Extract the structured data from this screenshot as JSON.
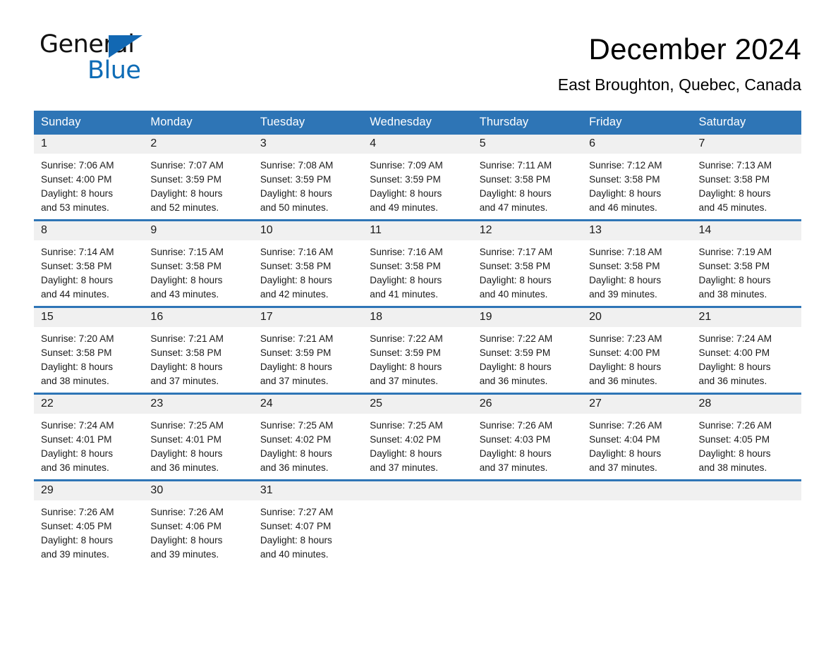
{
  "brand": {
    "word_one": "General",
    "word_two": "Blue",
    "flag_icon": "triangle-flag-icon"
  },
  "header": {
    "month_title": "December 2024",
    "location": "East Broughton, Quebec, Canada"
  },
  "colors": {
    "accent_blue": "#2e75b6",
    "brand_blue": "#0e6cb6",
    "daynum_band": "#f0f0f0",
    "text": "#1a1a1a"
  },
  "calendar": {
    "day_headers": [
      "Sunday",
      "Monday",
      "Tuesday",
      "Wednesday",
      "Thursday",
      "Friday",
      "Saturday"
    ],
    "weeks": [
      [
        {
          "day": "1",
          "sunrise": "Sunrise: 7:06 AM",
          "sunset": "Sunset: 4:00 PM",
          "daylight_line1": "Daylight: 8 hours",
          "daylight_line2": "and 53 minutes."
        },
        {
          "day": "2",
          "sunrise": "Sunrise: 7:07 AM",
          "sunset": "Sunset: 3:59 PM",
          "daylight_line1": "Daylight: 8 hours",
          "daylight_line2": "and 52 minutes."
        },
        {
          "day": "3",
          "sunrise": "Sunrise: 7:08 AM",
          "sunset": "Sunset: 3:59 PM",
          "daylight_line1": "Daylight: 8 hours",
          "daylight_line2": "and 50 minutes."
        },
        {
          "day": "4",
          "sunrise": "Sunrise: 7:09 AM",
          "sunset": "Sunset: 3:59 PM",
          "daylight_line1": "Daylight: 8 hours",
          "daylight_line2": "and 49 minutes."
        },
        {
          "day": "5",
          "sunrise": "Sunrise: 7:11 AM",
          "sunset": "Sunset: 3:58 PM",
          "daylight_line1": "Daylight: 8 hours",
          "daylight_line2": "and 47 minutes."
        },
        {
          "day": "6",
          "sunrise": "Sunrise: 7:12 AM",
          "sunset": "Sunset: 3:58 PM",
          "daylight_line1": "Daylight: 8 hours",
          "daylight_line2": "and 46 minutes."
        },
        {
          "day": "7",
          "sunrise": "Sunrise: 7:13 AM",
          "sunset": "Sunset: 3:58 PM",
          "daylight_line1": "Daylight: 8 hours",
          "daylight_line2": "and 45 minutes."
        }
      ],
      [
        {
          "day": "8",
          "sunrise": "Sunrise: 7:14 AM",
          "sunset": "Sunset: 3:58 PM",
          "daylight_line1": "Daylight: 8 hours",
          "daylight_line2": "and 44 minutes."
        },
        {
          "day": "9",
          "sunrise": "Sunrise: 7:15 AM",
          "sunset": "Sunset: 3:58 PM",
          "daylight_line1": "Daylight: 8 hours",
          "daylight_line2": "and 43 minutes."
        },
        {
          "day": "10",
          "sunrise": "Sunrise: 7:16 AM",
          "sunset": "Sunset: 3:58 PM",
          "daylight_line1": "Daylight: 8 hours",
          "daylight_line2": "and 42 minutes."
        },
        {
          "day": "11",
          "sunrise": "Sunrise: 7:16 AM",
          "sunset": "Sunset: 3:58 PM",
          "daylight_line1": "Daylight: 8 hours",
          "daylight_line2": "and 41 minutes."
        },
        {
          "day": "12",
          "sunrise": "Sunrise: 7:17 AM",
          "sunset": "Sunset: 3:58 PM",
          "daylight_line1": "Daylight: 8 hours",
          "daylight_line2": "and 40 minutes."
        },
        {
          "day": "13",
          "sunrise": "Sunrise: 7:18 AM",
          "sunset": "Sunset: 3:58 PM",
          "daylight_line1": "Daylight: 8 hours",
          "daylight_line2": "and 39 minutes."
        },
        {
          "day": "14",
          "sunrise": "Sunrise: 7:19 AM",
          "sunset": "Sunset: 3:58 PM",
          "daylight_line1": "Daylight: 8 hours",
          "daylight_line2": "and 38 minutes."
        }
      ],
      [
        {
          "day": "15",
          "sunrise": "Sunrise: 7:20 AM",
          "sunset": "Sunset: 3:58 PM",
          "daylight_line1": "Daylight: 8 hours",
          "daylight_line2": "and 38 minutes."
        },
        {
          "day": "16",
          "sunrise": "Sunrise: 7:21 AM",
          "sunset": "Sunset: 3:58 PM",
          "daylight_line1": "Daylight: 8 hours",
          "daylight_line2": "and 37 minutes."
        },
        {
          "day": "17",
          "sunrise": "Sunrise: 7:21 AM",
          "sunset": "Sunset: 3:59 PM",
          "daylight_line1": "Daylight: 8 hours",
          "daylight_line2": "and 37 minutes."
        },
        {
          "day": "18",
          "sunrise": "Sunrise: 7:22 AM",
          "sunset": "Sunset: 3:59 PM",
          "daylight_line1": "Daylight: 8 hours",
          "daylight_line2": "and 37 minutes."
        },
        {
          "day": "19",
          "sunrise": "Sunrise: 7:22 AM",
          "sunset": "Sunset: 3:59 PM",
          "daylight_line1": "Daylight: 8 hours",
          "daylight_line2": "and 36 minutes."
        },
        {
          "day": "20",
          "sunrise": "Sunrise: 7:23 AM",
          "sunset": "Sunset: 4:00 PM",
          "daylight_line1": "Daylight: 8 hours",
          "daylight_line2": "and 36 minutes."
        },
        {
          "day": "21",
          "sunrise": "Sunrise: 7:24 AM",
          "sunset": "Sunset: 4:00 PM",
          "daylight_line1": "Daylight: 8 hours",
          "daylight_line2": "and 36 minutes."
        }
      ],
      [
        {
          "day": "22",
          "sunrise": "Sunrise: 7:24 AM",
          "sunset": "Sunset: 4:01 PM",
          "daylight_line1": "Daylight: 8 hours",
          "daylight_line2": "and 36 minutes."
        },
        {
          "day": "23",
          "sunrise": "Sunrise: 7:25 AM",
          "sunset": "Sunset: 4:01 PM",
          "daylight_line1": "Daylight: 8 hours",
          "daylight_line2": "and 36 minutes."
        },
        {
          "day": "24",
          "sunrise": "Sunrise: 7:25 AM",
          "sunset": "Sunset: 4:02 PM",
          "daylight_line1": "Daylight: 8 hours",
          "daylight_line2": "and 36 minutes."
        },
        {
          "day": "25",
          "sunrise": "Sunrise: 7:25 AM",
          "sunset": "Sunset: 4:02 PM",
          "daylight_line1": "Daylight: 8 hours",
          "daylight_line2": "and 37 minutes."
        },
        {
          "day": "26",
          "sunrise": "Sunrise: 7:26 AM",
          "sunset": "Sunset: 4:03 PM",
          "daylight_line1": "Daylight: 8 hours",
          "daylight_line2": "and 37 minutes."
        },
        {
          "day": "27",
          "sunrise": "Sunrise: 7:26 AM",
          "sunset": "Sunset: 4:04 PM",
          "daylight_line1": "Daylight: 8 hours",
          "daylight_line2": "and 37 minutes."
        },
        {
          "day": "28",
          "sunrise": "Sunrise: 7:26 AM",
          "sunset": "Sunset: 4:05 PM",
          "daylight_line1": "Daylight: 8 hours",
          "daylight_line2": "and 38 minutes."
        }
      ],
      [
        {
          "day": "29",
          "sunrise": "Sunrise: 7:26 AM",
          "sunset": "Sunset: 4:05 PM",
          "daylight_line1": "Daylight: 8 hours",
          "daylight_line2": "and 39 minutes."
        },
        {
          "day": "30",
          "sunrise": "Sunrise: 7:26 AM",
          "sunset": "Sunset: 4:06 PM",
          "daylight_line1": "Daylight: 8 hours",
          "daylight_line2": "and 39 minutes."
        },
        {
          "day": "31",
          "sunrise": "Sunrise: 7:27 AM",
          "sunset": "Sunset: 4:07 PM",
          "daylight_line1": "Daylight: 8 hours",
          "daylight_line2": "and 40 minutes."
        },
        {
          "day": "",
          "sunrise": "",
          "sunset": "",
          "daylight_line1": "",
          "daylight_line2": ""
        },
        {
          "day": "",
          "sunrise": "",
          "sunset": "",
          "daylight_line1": "",
          "daylight_line2": ""
        },
        {
          "day": "",
          "sunrise": "",
          "sunset": "",
          "daylight_line1": "",
          "daylight_line2": ""
        },
        {
          "day": "",
          "sunrise": "",
          "sunset": "",
          "daylight_line1": "",
          "daylight_line2": ""
        }
      ]
    ]
  }
}
